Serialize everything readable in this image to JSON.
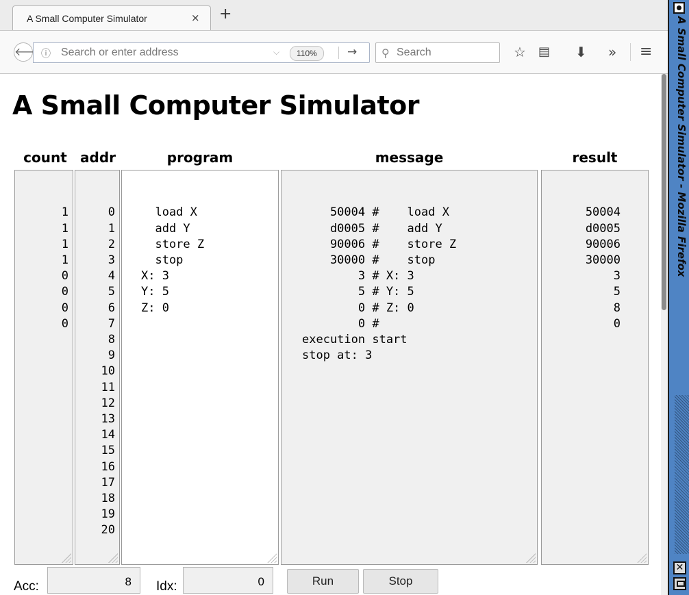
{
  "browser": {
    "tab_title": "A Small Computer Simulator",
    "tab_close": "×",
    "new_tab": "+",
    "url_placeholder": "Search or enter address",
    "zoom": "110%",
    "search_placeholder": "Search",
    "icons": [
      "back-arrow-icon",
      "info-icon",
      "dropdown-icon",
      "go-arrow-icon",
      "search-icon",
      "star-icon",
      "reader-view-icon",
      "download-icon",
      "overflow-icon",
      "hamburger-menu-icon"
    ]
  },
  "window": {
    "title": "A Small Computer Simulator - Mozilla Firefox"
  },
  "page": {
    "title": "A Small Computer Simulator",
    "columns": {
      "count": "count",
      "addr": "addr",
      "program": "program",
      "message": "message",
      "result": "result"
    },
    "count_lines": [
      "1",
      "1",
      "1",
      "1",
      "0",
      "0",
      "0",
      "0"
    ],
    "addr_lines": [
      "0",
      "1",
      "2",
      "3",
      "4",
      "5",
      "6",
      "7",
      "8",
      "9",
      "10",
      "11",
      "12",
      "13",
      "14",
      "15",
      "16",
      "17",
      "18",
      "19",
      "20"
    ],
    "program_lines": [
      "  load X",
      "  add Y",
      "  store Z",
      "  stop",
      "X: 3",
      "Y: 5",
      "Z: 0"
    ],
    "message_lines": [
      "    50004 #    load X",
      "    d0005 #    add Y",
      "    90006 #    store Z",
      "    30000 #    stop",
      "        3 # X: 3",
      "        5 # Y: 5",
      "        0 # Z: 0",
      "        0 #",
      "execution start",
      "stop at: 3"
    ],
    "result_lines": [
      "50004",
      "d0005",
      "90006",
      "30000",
      "3",
      "5",
      "8",
      "0"
    ],
    "acc_label": "Acc:",
    "acc_value": "8",
    "idx_label": "Idx:",
    "idx_value": "0",
    "run_label": "Run",
    "stop_label": "Stop"
  }
}
